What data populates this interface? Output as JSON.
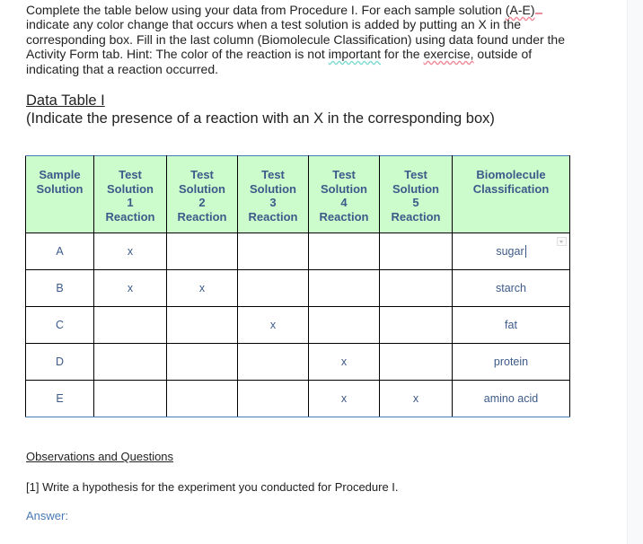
{
  "intro": {
    "part1": "Complete the table below using your data from Procedure I. For each sample solution ",
    "part_sq1": "(A-E)",
    "part2": " indicate any color change that occurs when a test solution is added by putting an X in the corresponding box. Fill in the last column (Biomolecule Classification) using data found under the Activity Form tab. Hint: The color of the reaction is not ",
    "part_sq2": "important",
    "part3": " for the ",
    "part_sq3": "exercise,",
    "part4": " outside of indicating that a reaction occurred."
  },
  "table_title": "Data Table I",
  "table_subtitle": "(Indicate the presence of a reaction with an X in the corresponding box)",
  "table": {
    "headers": [
      [
        "Sample",
        "Solution"
      ],
      [
        "Test",
        "Solution",
        "1",
        "Reaction"
      ],
      [
        "Test",
        "Solution",
        "2",
        "Reaction"
      ],
      [
        "Test",
        "Solution",
        "3",
        "Reaction"
      ],
      [
        "Test",
        "Solution",
        "4",
        "Reaction"
      ],
      [
        "Test",
        "Solution",
        "5",
        "Reaction"
      ],
      [
        "Biomolecule",
        "Classification"
      ]
    ],
    "rows": [
      [
        "A",
        "x",
        "",
        "",
        "",
        "",
        "sugar"
      ],
      [
        "B",
        "x",
        "x",
        "",
        "",
        "",
        "starch"
      ],
      [
        "C",
        "",
        "",
        "x",
        "",
        "",
        "fat"
      ],
      [
        "D",
        "",
        "",
        "",
        "x",
        "",
        "protein"
      ],
      [
        "E",
        "",
        "",
        "",
        "x",
        "x",
        "amino acid"
      ]
    ]
  },
  "observations_title": "Observations and Questions",
  "question1": "[1] Write a hypothesis for the experiment you conducted for Procedure I.",
  "answer_label": "Answer:",
  "colors": {
    "header_bg": "#ccfccc",
    "cell_text": "#3d5a8a",
    "answer_text": "#4a7ab5"
  }
}
